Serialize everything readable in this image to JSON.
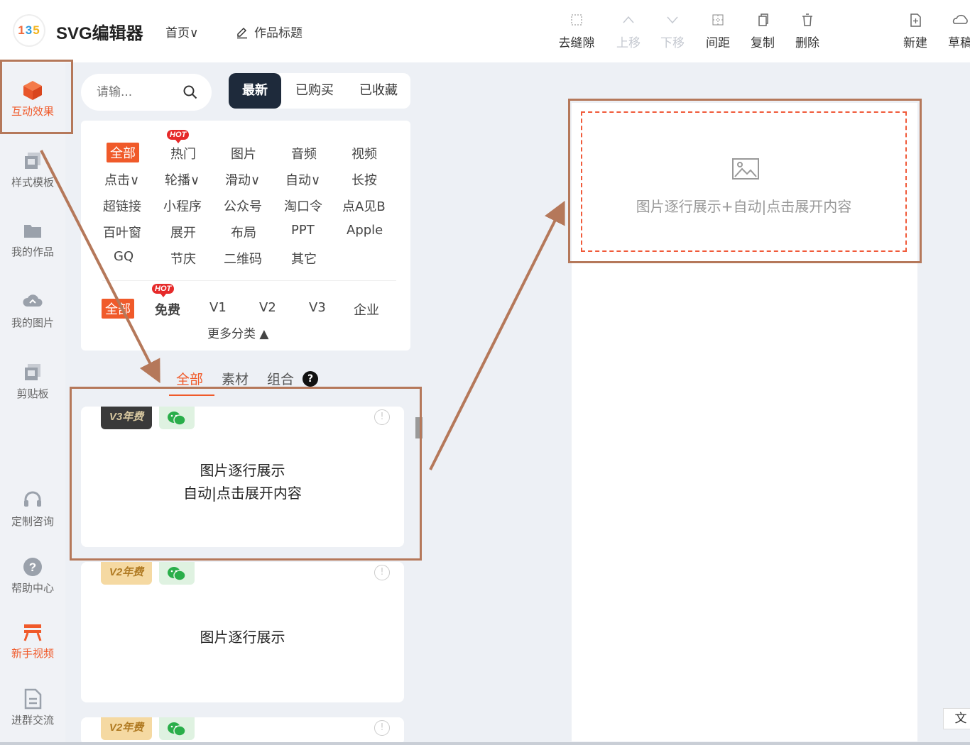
{
  "header": {
    "logo_text": "135",
    "app_title": "SVG编辑器",
    "home_menu": "首页∨",
    "work_title": "作品标题",
    "tools": [
      {
        "label": "去缝隙",
        "icon": "fill-gap-icon"
      },
      {
        "label": "上移",
        "icon": "move-up-icon"
      },
      {
        "label": "下移",
        "icon": "move-down-icon"
      },
      {
        "label": "间距",
        "icon": "spacing-icon"
      },
      {
        "label": "复制",
        "icon": "copy-icon"
      },
      {
        "label": "删除",
        "icon": "trash-icon"
      },
      {
        "label": "新建",
        "icon": "new-file-icon"
      },
      {
        "label": "草稿",
        "icon": "cloud-icon"
      }
    ]
  },
  "sidebar": {
    "items": [
      {
        "label": "互动效果",
        "icon": "cube-icon"
      },
      {
        "label": "样式模板",
        "icon": "template-icon"
      },
      {
        "label": "我的作品",
        "icon": "folder-icon"
      },
      {
        "label": "我的图片",
        "icon": "cloud-image-icon"
      },
      {
        "label": "剪贴板",
        "icon": "clipboard-icon"
      },
      {
        "label": "定制咨询",
        "icon": "headset-icon"
      },
      {
        "label": "帮助中心",
        "icon": "help-icon"
      },
      {
        "label": "新手视频",
        "icon": "video-icon"
      },
      {
        "label": "进群交流",
        "icon": "document-icon"
      }
    ]
  },
  "panel": {
    "search_placeholder": "请输...",
    "segments": [
      "最新",
      "已购买",
      "已收藏"
    ],
    "categories": [
      "全部",
      "热门",
      "图片",
      "音频",
      "视频",
      "点击∨",
      "轮播∨",
      "滑动∨",
      "自动∨",
      "长按",
      "超链接",
      "小程序",
      "公众号",
      "淘口令",
      "点A见B",
      "百叶窗",
      "展开",
      "布局",
      "PPT",
      "Apple",
      "GQ",
      "节庆",
      "二维码",
      "其它"
    ],
    "hot_badge": "HOT",
    "tiers": [
      "全部",
      "免费",
      "V1",
      "V2",
      "V3",
      "企业"
    ],
    "more_label": "更多分类 ▲",
    "subtabs": [
      "全部",
      "素材",
      "组合"
    ],
    "help_mark": "?",
    "templates": [
      {
        "badge": "V3年费",
        "lines": [
          "图片逐行展示",
          "自动|点击展开内容"
        ]
      },
      {
        "badge": "V2年费",
        "lines": [
          "图片逐行展示"
        ]
      },
      {
        "badge": "V2年费",
        "lines": []
      }
    ],
    "info_mark": "!"
  },
  "canvas": {
    "placeholder_text": "图片逐行展示+自动|点击展开内容",
    "side_button": "文"
  },
  "colors": {
    "accent": "#f05a2a",
    "highlight": "#b5785a",
    "dark_segment": "#1e2a3b"
  }
}
